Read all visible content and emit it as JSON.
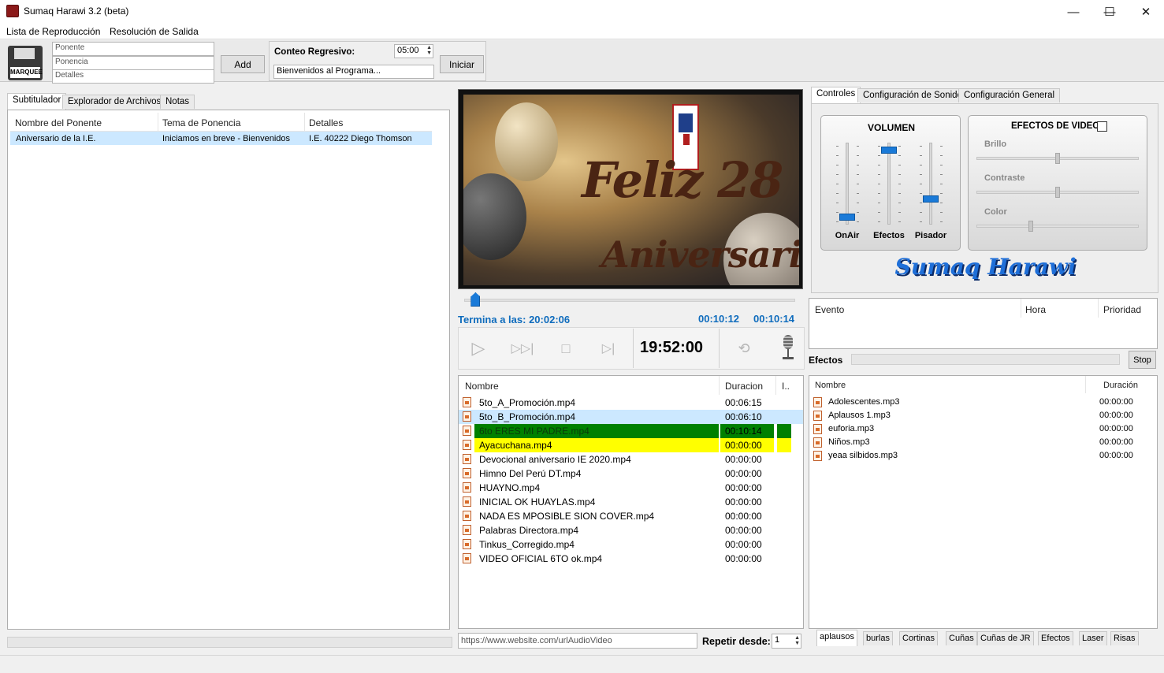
{
  "window": {
    "title": "Sumaq Harawi 3.2 (beta)",
    "minimize": "—",
    "maximize": "☐",
    "close": "✕"
  },
  "menu": [
    "Lista de Reproducción",
    "Resolución de Salida"
  ],
  "toolbar": {
    "marquee_label": "MARQUEE",
    "ponente_placeholder": "Ponente",
    "ponencia_placeholder": "Ponencia",
    "detalles_placeholder": "Detalles",
    "add_label": "Add",
    "countdown_label": "Conteo Regresivo:",
    "countdown_value": "05:00",
    "message_value": "Bienvenidos al Programa...",
    "start_label": "Iniciar"
  },
  "left_tabs": [
    "Subtitulador",
    "Explorador de Archivos",
    "Notas"
  ],
  "subtitles": {
    "columns": [
      "Nombre del Ponente",
      "Tema de Ponencia",
      "Detalles"
    ],
    "rows": [
      [
        "Aniversario de la I.E.",
        "Iniciamos en breve - Bienvenidos",
        "I.E. 40222 Diego Thomson"
      ]
    ]
  },
  "preview": {
    "line1": "Feliz 28",
    "line2": "Aniversario"
  },
  "player": {
    "ends_at_label": "Termina a las: 20:02:06",
    "elapsed": "00:10:12",
    "total": "00:10:14",
    "clock": "19:52:00",
    "progress": 0.02
  },
  "playlist": {
    "columns": [
      "Nombre",
      "Duracion",
      "I.."
    ],
    "rows": [
      {
        "name": "5to_A_Promoción.mp4",
        "dur": "00:06:15",
        "state": "normal"
      },
      {
        "name": "5to_B_Promoción.mp4",
        "dur": "00:06:10",
        "state": "selected"
      },
      {
        "name": "6to ERES MI PADRE.mp4",
        "dur": "00:10:14",
        "state": "playing"
      },
      {
        "name": "Ayacuchana.mp4",
        "dur": "00:00:00",
        "state": "next"
      },
      {
        "name": "Devocional aniversario IE 2020.mp4",
        "dur": "00:00:00",
        "state": "normal"
      },
      {
        "name": "Himno Del Perú DT.mp4",
        "dur": "00:00:00",
        "state": "normal"
      },
      {
        "name": "HUAYNO.mp4",
        "dur": "00:00:00",
        "state": "normal"
      },
      {
        "name": "INICIAL OK HUAYLAS.mp4",
        "dur": "00:00:00",
        "state": "normal"
      },
      {
        "name": "NADA ES MPOSIBLE SION COVER.mp4",
        "dur": "00:00:00",
        "state": "normal"
      },
      {
        "name": "Palabras Directora.mp4",
        "dur": "00:00:00",
        "state": "normal"
      },
      {
        "name": "Tinkus_Corregido.mp4",
        "dur": "00:00:00",
        "state": "normal"
      },
      {
        "name": "VIDEO OFICIAL 6TO ok.mp4",
        "dur": "00:00:00",
        "state": "normal"
      }
    ]
  },
  "url_placeholder": "https://www.website.com/urlAudioVideo",
  "repeat": {
    "label": "Repetir desde:",
    "value": "1"
  },
  "right_tabs": [
    "Controles",
    "Configuración de Sonido",
    "Configuración General"
  ],
  "volume": {
    "title": "VOLUMEN",
    "channels": [
      {
        "label": "OnAir",
        "level": 0.05
      },
      {
        "label": "Efectos",
        "level": 0.95
      },
      {
        "label": "Pisador",
        "level": 0.3
      }
    ]
  },
  "video_effects": {
    "title": "EFECTOS DE VIDEO",
    "enabled": false,
    "sliders": [
      {
        "label": "Brillo",
        "level": 0.5
      },
      {
        "label": "Contraste",
        "level": 0.5
      },
      {
        "label": "Color",
        "level": 0.33
      }
    ]
  },
  "brand": "Sumaq Harawi",
  "events": {
    "columns": [
      "Evento",
      "Hora",
      "Prioridad"
    ]
  },
  "effects_bar": {
    "label": "Efectos",
    "stop_label": "Stop"
  },
  "sounds": {
    "columns": [
      "Nombre",
      "Duración"
    ],
    "rows": [
      {
        "name": "Adolescentes.mp3",
        "dur": "00:00:00"
      },
      {
        "name": "Aplausos 1.mp3",
        "dur": "00:00:00"
      },
      {
        "name": "euforia.mp3",
        "dur": "00:00:00"
      },
      {
        "name": "Niños.mp3",
        "dur": "00:00:00"
      },
      {
        "name": "yeaa silbidos.mp3",
        "dur": "00:00:00"
      }
    ]
  },
  "sound_tabs": [
    "aplausos",
    "burlas",
    "Cortinas",
    "Cuñas",
    "Cuñas de JR",
    "Efectos",
    "Laser",
    "Risas"
  ],
  "colors": {
    "playing": "#008000",
    "next": "#ffff00",
    "selected": "#cce8ff",
    "accent": "#0f6cbd"
  }
}
